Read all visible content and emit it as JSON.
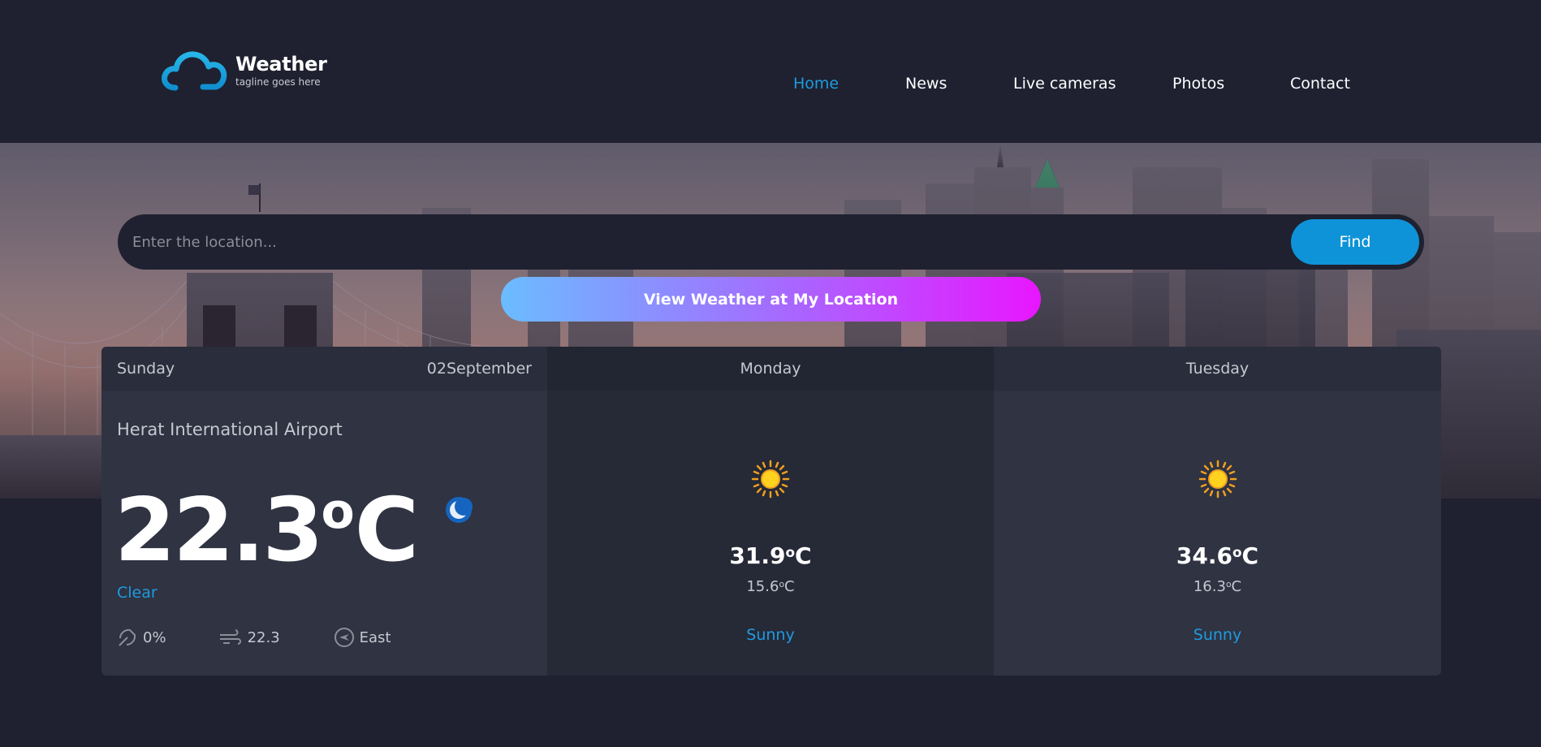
{
  "app": {
    "title": "Weather",
    "tagline": "tagline goes here"
  },
  "nav": {
    "items": [
      {
        "label": "Home",
        "active": true
      },
      {
        "label": "News",
        "active": false
      },
      {
        "label": "Live cameras",
        "active": false
      },
      {
        "label": "Photos",
        "active": false
      },
      {
        "label": "Contact",
        "active": false
      }
    ]
  },
  "search": {
    "placeholder": "Enter the location...",
    "value": "",
    "find_label": "Find",
    "locate_label": "View Weather at My Location"
  },
  "today": {
    "day": "Sunday",
    "date": "02September",
    "location": "Herat International Airport",
    "temperature": "22.3",
    "degree": "o",
    "unit": "C",
    "condition": "Clear",
    "icon": "moon-icon",
    "precipitation": "0%",
    "wind_speed": "22.3",
    "wind_direction": "East"
  },
  "forecast": [
    {
      "day": "Monday",
      "max": "31.9",
      "min": "15.6",
      "degree": "o",
      "unit": "C",
      "condition": "Sunny",
      "icon": "sun-icon"
    },
    {
      "day": "Tuesday",
      "max": "34.6",
      "min": "16.3",
      "degree": "o",
      "unit": "C",
      "condition": "Sunny",
      "icon": "sun-icon"
    }
  ],
  "colors": {
    "background": "#1f2130",
    "accent": "#1e9be0",
    "find_button": "#0f93d8",
    "gradient_start": "#6bbcff",
    "gradient_end": "#e816ff",
    "panel": "#2f3342",
    "panel_alt": "#262936"
  }
}
